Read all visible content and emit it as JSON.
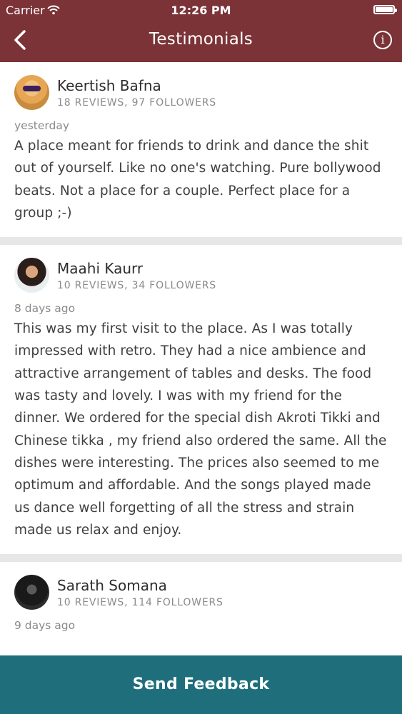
{
  "status_bar": {
    "carrier": "Carrier",
    "time": "12:26 PM",
    "wifi_icon": "wifi-icon",
    "battery_icon": "battery-icon"
  },
  "nav": {
    "title": "Testimonials",
    "back_icon": "chevron-left-icon",
    "info_icon": "info-icon",
    "info_glyph": "i"
  },
  "reviews": [
    {
      "name": "Keertish Bafna",
      "meta": "18 REVIEWS, 97 FOLLOWERS",
      "when": "yesterday",
      "text": "A place meant for friends to drink and dance the shit out of yourself. Like no one's watching. Pure bollywood beats. Not a place for a couple. Perfect place for a group ;-)"
    },
    {
      "name": "Maahi Kaurr",
      "meta": "10 REVIEWS, 34 FOLLOWERS",
      "when": "8 days ago",
      "text": "This was my first visit to the place. As I was totally impressed with retro. They had a nice ambience and attractive arrangement of tables and desks. The food was tasty and lovely. I was with my friend for the dinner. We ordered for the special dish Akroti Tikki and Chinese tikka , my friend also ordered the same. All the dishes were interesting. The prices also seemed to me optimum and affordable. And the songs played made us dance well forgetting of all the stress and strain made us relax and enjoy."
    },
    {
      "name": "Sarath Somana",
      "meta": "10 REVIEWS, 114 FOLLOWERS",
      "when": "9 days ago",
      "text": ""
    }
  ],
  "footer": {
    "button_label": "Send Feedback"
  },
  "colors": {
    "header": "#7b3338",
    "footer": "#1e6f7b",
    "separator": "#e7e7e7"
  }
}
